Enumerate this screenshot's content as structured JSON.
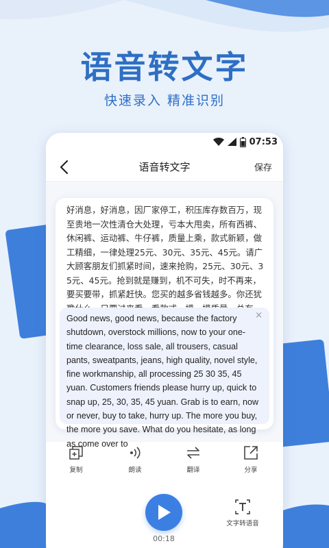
{
  "hero": {
    "title": "语音转文字",
    "subtitle": "快速录入  精准识别"
  },
  "status_bar": {
    "time": "07:53",
    "icons": [
      "wifi-icon",
      "signal-icon",
      "battery-icon"
    ]
  },
  "app_bar": {
    "title": "语音转文字",
    "save_label": "保存"
  },
  "transcript": {
    "source_text": "好消息，好消息，因厂家停工，积压库存数百万，现至贵地一次性清仓大处理，亏本大甩卖，所有西裤、休闲裤、运动裤、牛仔裤，质量上乘，款式新颖，做工精细，一律处理25元、30元、35元、45元。请广大顾客朋友们抓紧时间，速来抢购，25元、30元、35元、45元。抢到就是赚到，机不可失，时不再来，要买要带，抓紧赶快。您买的越多省钱越多。你还犹豫什么，只要过来看一看款式，摸一摸质量，总有一条适合你，我们不计",
    "translation": "Good news, good news, because the factory shutdown, overstock millions, now to your one-time clearance, loss sale, all trousers, casual pants, sweatpants, jeans, high quality, novel style, fine workmanship, all processing 25 30 35, 45 yuan. Customers friends please hurry up, quick to snap up, 25, 30, 35, 45 yuan. Grab is to earn, now or never, buy to take, hurry up. The more you buy, the more you save. What do you hesitate, as long as come over to",
    "close_symbol": "×"
  },
  "tools": [
    {
      "label": "复制",
      "icon": "copy-icon"
    },
    {
      "label": "朗读",
      "icon": "read-aloud-icon"
    },
    {
      "label": "翻译",
      "icon": "translate-icon"
    },
    {
      "label": "分享",
      "icon": "share-icon"
    }
  ],
  "player": {
    "duration": "00:18",
    "tts_label": "文字转语音",
    "play_icon": "play-icon",
    "tts_icon": "text-to-speech-icon"
  },
  "colors": {
    "accent": "#3c7fe3",
    "hero_text": "#2e6fc4",
    "background": "#e9f1fb",
    "wave_dark": "#3e7fdc",
    "wave_light": "#6aa3ea"
  }
}
